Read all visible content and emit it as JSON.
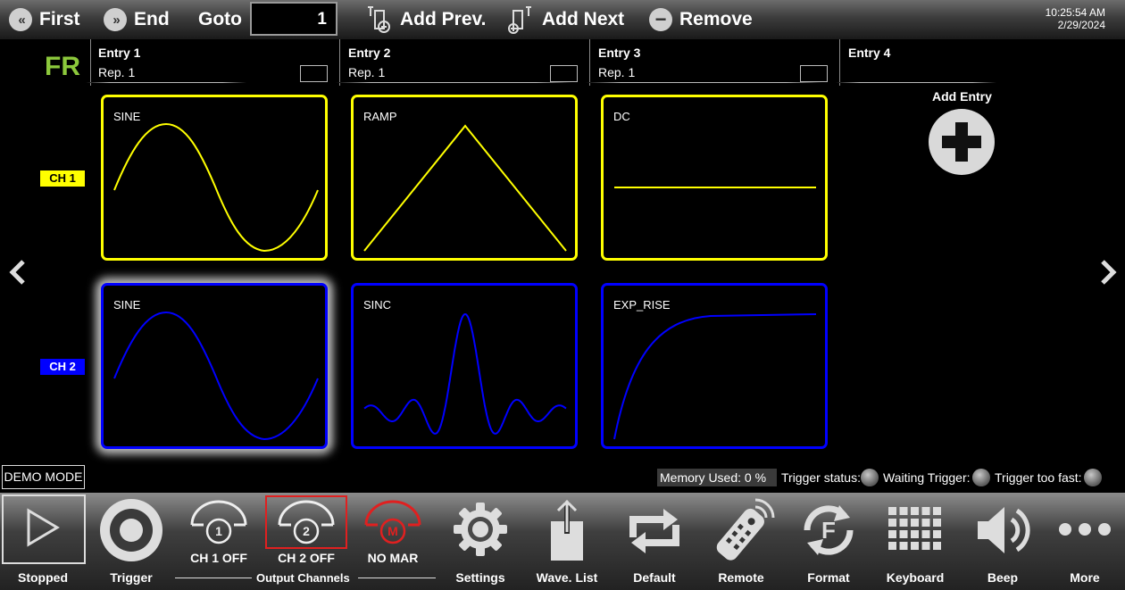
{
  "toolbar": {
    "first_label": "First",
    "end_label": "End",
    "goto_label": "Goto",
    "goto_value": "1",
    "add_prev_label": "Add Prev.",
    "add_next_label": "Add Next",
    "remove_label": "Remove",
    "time": "10:25:54 AM",
    "date": "2/29/2024"
  },
  "sequence": {
    "mode_badge": "FR",
    "entries": [
      {
        "title": "Entry  1",
        "rep": "Rep.  1"
      },
      {
        "title": "Entry  2",
        "rep": "Rep.  1"
      },
      {
        "title": "Entry  3",
        "rep": "Rep.  1"
      },
      {
        "title": "Entry  4"
      }
    ],
    "add_entry_label": "Add Entry",
    "channels": [
      {
        "label": "CH 1",
        "color": "#ffff00",
        "waves": [
          "SINE",
          "RAMP",
          "DC"
        ]
      },
      {
        "label": "CH 2",
        "color": "#0000ff",
        "waves": [
          "SINE",
          "SINC",
          "EXP_RISE"
        ]
      }
    ]
  },
  "status": {
    "demo_mode": "DEMO MODE",
    "memory_used": "Memory Used:  0 %",
    "trigger_status": "Trigger status:",
    "waiting_trigger": "Waiting Trigger:",
    "trigger_too_fast": "Trigger too fast:"
  },
  "bottom": {
    "stopped": "Stopped",
    "trigger": "Trigger",
    "ch1": "CH 1 OFF",
    "ch1_num": "1",
    "ch2": "CH 2 OFF",
    "ch2_num": "2",
    "mar": "NO MAR",
    "mar_letter": "M",
    "output_channels": "Output Channels",
    "settings": "Settings",
    "wave_list": "Wave. List",
    "default": "Default",
    "remote": "Remote",
    "format": "Format",
    "format_letter": "F",
    "keyboard": "Keyboard",
    "beep": "Beep",
    "more": "More"
  },
  "colors": {
    "accent_green": "#8cc83c",
    "selected_border": "#e02020"
  }
}
